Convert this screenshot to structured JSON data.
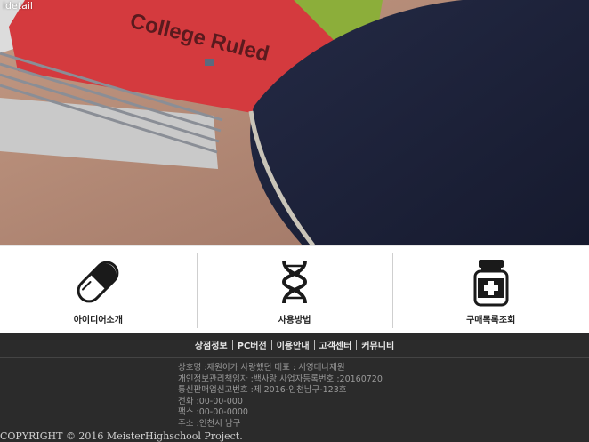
{
  "hero": {
    "caption": "idetail",
    "notebook_text": "College Ruled"
  },
  "menu": {
    "items": [
      {
        "label": "아이디어소개",
        "icon": "capsule-icon"
      },
      {
        "label": "사용방법",
        "icon": "dna-icon"
      },
      {
        "label": "구매목록조회",
        "icon": "medicine-bottle-icon"
      }
    ]
  },
  "footer": {
    "nav": [
      "상점정보",
      "PC버전",
      "이용안내",
      "고객센터",
      "커뮤니티"
    ],
    "info": [
      "상호명 :재원이가 사랑했던   대표 : 서영태나재원",
      "개인정보관리책임자 :백사랑   사업자등록번호 :20160720",
      "통신판매업신고번호 :제 2016-인천남구-123호",
      "전화 :00-00-000",
      "팩스 :00-00-0000",
      "주소 :인천시 남구"
    ],
    "copyright": "COPYRIGHT © 2016 MeisterHighschool Project."
  },
  "colors": {
    "footer_bg": "#2b2b2b",
    "notebook_red": "#d63a3e",
    "shirt_navy": "#1d2138"
  }
}
